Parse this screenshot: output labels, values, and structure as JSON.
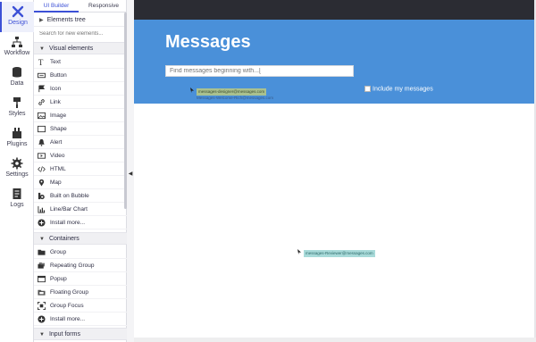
{
  "rail": [
    {
      "label": "Design",
      "icon": "design-icon",
      "active": true
    },
    {
      "label": "Workflow",
      "icon": "workflow-icon"
    },
    {
      "label": "Data",
      "icon": "data-icon"
    },
    {
      "label": "Styles",
      "icon": "styles-icon"
    },
    {
      "label": "Plugins",
      "icon": "plugins-icon"
    },
    {
      "label": "Settings",
      "icon": "settings-icon"
    },
    {
      "label": "Logs",
      "icon": "logs-icon"
    }
  ],
  "panel": {
    "tabs": [
      "UI Builder",
      "Responsive"
    ],
    "elements_tree": "Elements tree",
    "search_placeholder": "Search for new elements...",
    "sections": {
      "visual": "Visual elements",
      "containers": "Containers",
      "inputs": "Input forms"
    },
    "visual_items": [
      {
        "label": "Text",
        "icon": "text-icon"
      },
      {
        "label": "Button",
        "icon": "button-icon"
      },
      {
        "label": "Icon",
        "icon": "flag-icon"
      },
      {
        "label": "Link",
        "icon": "link-icon"
      },
      {
        "label": "Image",
        "icon": "image-icon"
      },
      {
        "label": "Shape",
        "icon": "shape-icon"
      },
      {
        "label": "Alert",
        "icon": "bell-icon"
      },
      {
        "label": "Video",
        "icon": "video-icon"
      },
      {
        "label": "HTML",
        "icon": "code-icon"
      },
      {
        "label": "Map",
        "icon": "map-pin-icon"
      },
      {
        "label": "Built on Bubble",
        "icon": "bubble-icon"
      },
      {
        "label": "Line/Bar Chart",
        "icon": "chart-icon"
      },
      {
        "label": "Install more...",
        "icon": "plus-circle-icon"
      }
    ],
    "container_items": [
      {
        "label": "Group",
        "icon": "folder-icon"
      },
      {
        "label": "Repeating Group",
        "icon": "repeating-group-icon"
      },
      {
        "label": "Popup",
        "icon": "popup-icon"
      },
      {
        "label": "Floating Group",
        "icon": "floating-group-icon"
      },
      {
        "label": "Group Focus",
        "icon": "group-focus-icon"
      },
      {
        "label": "Install more...",
        "icon": "plus-circle-icon"
      }
    ]
  },
  "canvas": {
    "title": "Messages",
    "search_placeholder": "Find messages beginning with...[",
    "include_label": "Include my messages",
    "chip1": "messages-designer@messages.com",
    "chip1_sub": "Messages-Welcome-Rich@messages.com",
    "chip2": "messages-Reviewer@messages.com"
  },
  "colors": {
    "accent": "#3c50d6",
    "hero": "#4a90d9",
    "topbar": "#2b2c33"
  }
}
